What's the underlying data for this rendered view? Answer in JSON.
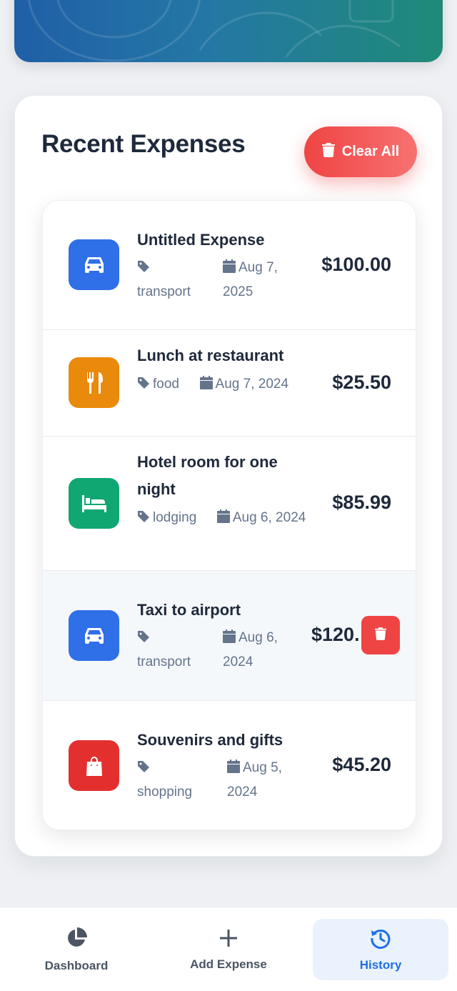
{
  "recent": {
    "title": "Recent Expenses",
    "clear_all_label": "Clear All"
  },
  "expenses": [
    {
      "title": "Untitled Expense",
      "category": "transport",
      "date_line1": "Aug 7,",
      "date_line2": "2025",
      "amount": "$100.00",
      "icon": "car-icon",
      "color": "#2f6fe8"
    },
    {
      "title": "Lunch at restaurant",
      "category": "food",
      "date": "Aug 7, 2024",
      "amount": "$25.50",
      "icon": "utensils-icon",
      "color": "#ea8a0c"
    },
    {
      "title_line1": "Hotel room for one",
      "title_line2": "night",
      "category": "lodging",
      "date": "Aug 6, 2024",
      "amount": "$85.99",
      "icon": "bed-icon",
      "color": "#10a772"
    },
    {
      "title": "Taxi to airport",
      "category": "transport",
      "date_line1": "Aug 6,",
      "date_line2": "2024",
      "amount": "$120.",
      "icon": "car-icon",
      "color": "#2f6fe8"
    },
    {
      "title": "Souvenirs and gifts",
      "category": "shopping",
      "date_line1": "Aug 5,",
      "date_line2": "2024",
      "amount": "$45.20",
      "icon": "shopping-bag-icon",
      "color": "#e42f2f"
    }
  ],
  "nav": {
    "dashboard": "Dashboard",
    "add_expense": "Add Expense",
    "history": "History"
  },
  "colors": {
    "accent": "#1d6fe8",
    "danger": "#ef4444"
  }
}
